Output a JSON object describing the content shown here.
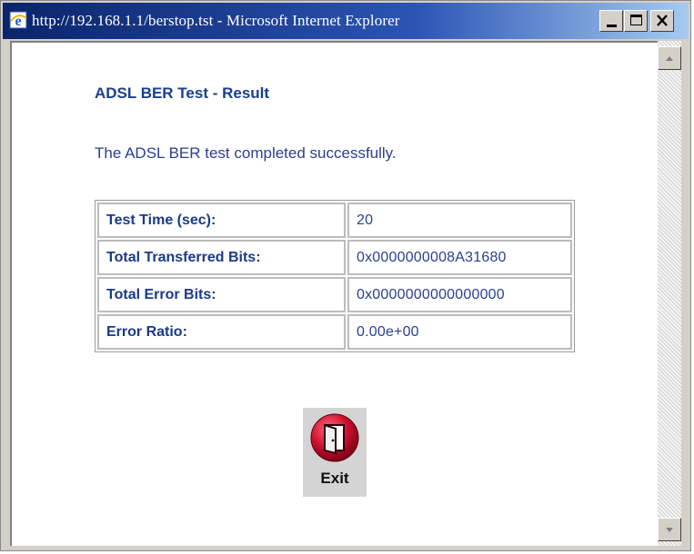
{
  "window": {
    "title": "http://192.168.1.1/berstop.tst - Microsoft Internet Explorer"
  },
  "page": {
    "heading": "ADSL BER Test - Result",
    "message": "The ADSL BER test completed successfully.",
    "results": [
      {
        "label": "Test Time (sec):",
        "value": "20"
      },
      {
        "label": "Total Transferred Bits:",
        "value": "0x0000000008A31680"
      },
      {
        "label": "Total Error Bits:",
        "value": "0x0000000000000000"
      },
      {
        "label": "Error Ratio:",
        "value": "0.00e+00"
      }
    ],
    "exit_label": "Exit"
  },
  "colors": {
    "title_bar": "#0a246a",
    "link_blue": "#1a3f91",
    "exit_red": "#c8102e"
  },
  "icons": {
    "browser": "ie-icon",
    "minimize": "minimize-icon",
    "maximize": "maximize-icon",
    "close": "close-icon",
    "exit": "exit-door-icon"
  }
}
